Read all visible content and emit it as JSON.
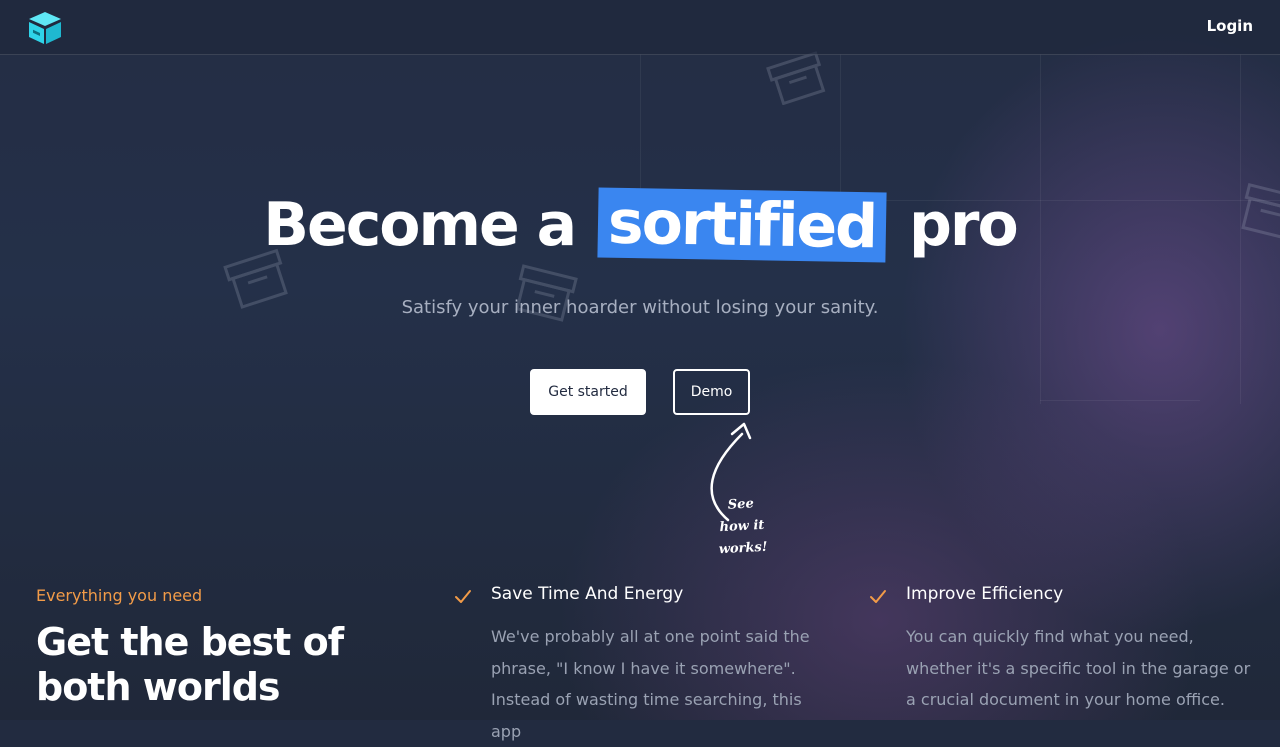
{
  "header": {
    "logo_icon": "box-icon",
    "login_label": "Login"
  },
  "hero": {
    "title_before": "Become a",
    "title_highlight": "sortified",
    "title_after": "pro",
    "subtitle": "Satisfy your inner hoarder without losing your sanity.",
    "primary_button": "Get started",
    "secondary_button": "Demo",
    "note_line1": "See",
    "note_line2": "how it",
    "note_line3": "works!"
  },
  "features": {
    "eyebrow": "Everything you need",
    "title": "Get the best of both worlds",
    "items": [
      {
        "icon": "check-icon",
        "title": "Save Time And Energy",
        "description": "We've probably all at one point said the phrase, \"I know I have it somewhere\". Instead of wasting time searching, this app"
      },
      {
        "icon": "check-icon",
        "title": "Improve Efficiency",
        "description": "You can quickly find what you need, whether it's a specific tool in the garage or a crucial document in your home office."
      }
    ]
  },
  "colors": {
    "background": "#222b40",
    "highlight": "#3a86f0",
    "accent": "#f29b48",
    "logo": "#2fd3e8"
  }
}
